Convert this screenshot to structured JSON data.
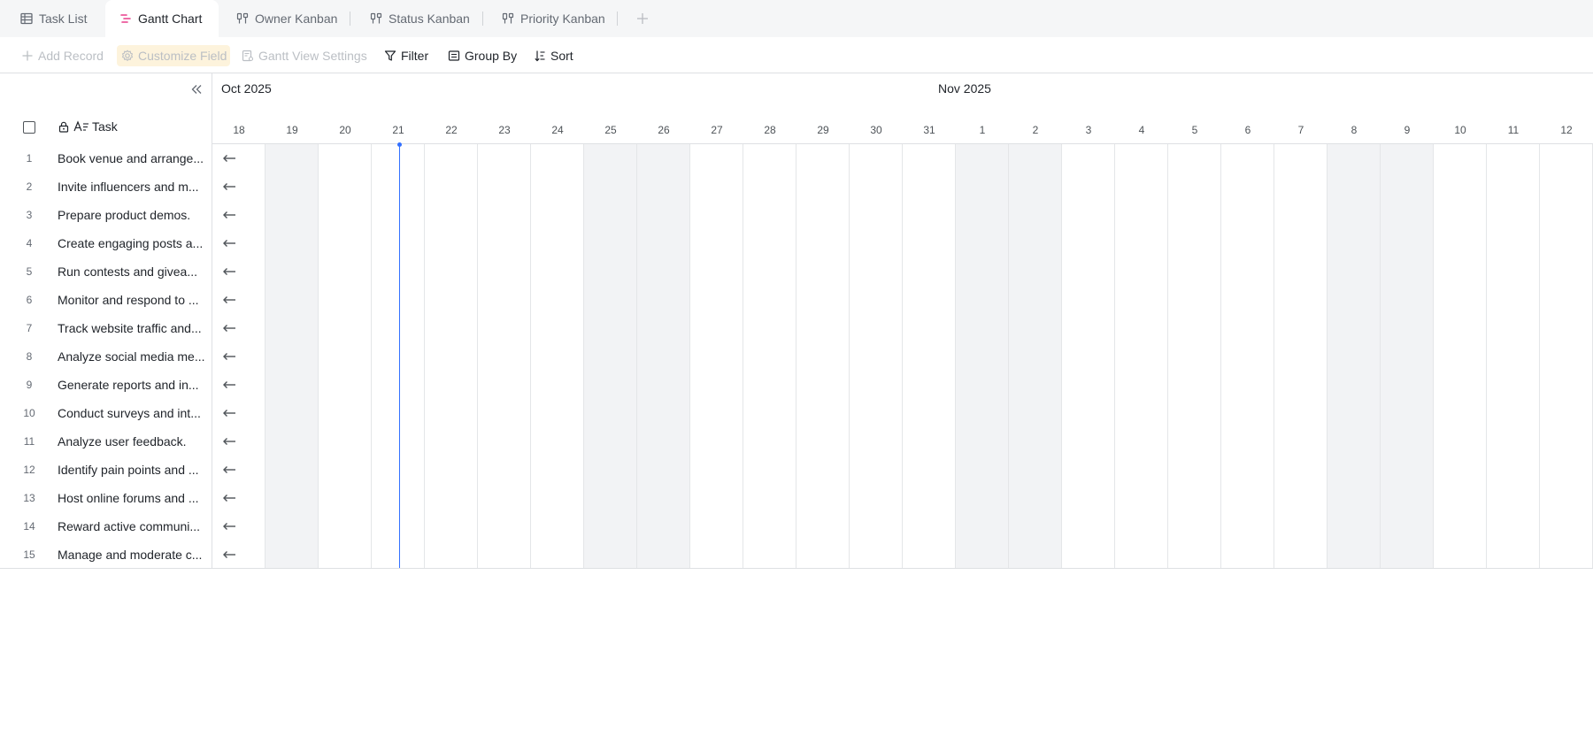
{
  "tabs": [
    {
      "id": "task-list",
      "label": "Task List",
      "icon": "table-icon",
      "active": false
    },
    {
      "id": "gantt-chart",
      "label": "Gantt Chart",
      "icon": "gantt-icon",
      "active": true
    },
    {
      "id": "owner-kanban",
      "label": "Owner Kanban",
      "icon": "kanban-icon",
      "active": false
    },
    {
      "id": "status-kanban",
      "label": "Status Kanban",
      "icon": "kanban-icon",
      "active": false
    },
    {
      "id": "priority-kanban",
      "label": "Priority Kanban",
      "icon": "kanban-icon",
      "active": false
    }
  ],
  "toolbar": {
    "add_record": "Add Record",
    "customize_field": "Customize Field",
    "gantt_view_settings": "Gantt View Settings",
    "filter": "Filter",
    "group_by": "Group By",
    "sort": "Sort"
  },
  "grid": {
    "field_header": "Task",
    "rows": [
      {
        "num": "1",
        "title": "Book venue and arrange..."
      },
      {
        "num": "2",
        "title": "Invite influencers and m..."
      },
      {
        "num": "3",
        "title": "Prepare product demos."
      },
      {
        "num": "4",
        "title": "Create engaging posts a..."
      },
      {
        "num": "5",
        "title": "Run contests and givea..."
      },
      {
        "num": "6",
        "title": "Monitor and respond to ..."
      },
      {
        "num": "7",
        "title": "Track website traffic and..."
      },
      {
        "num": "8",
        "title": "Analyze social media me..."
      },
      {
        "num": "9",
        "title": "Generate reports and in..."
      },
      {
        "num": "10",
        "title": "Conduct surveys and int..."
      },
      {
        "num": "11",
        "title": "Analyze user feedback."
      },
      {
        "num": "12",
        "title": "Identify pain points and ..."
      },
      {
        "num": "13",
        "title": "Host online forums and ..."
      },
      {
        "num": "14",
        "title": "Reward active communi..."
      },
      {
        "num": "15",
        "title": "Manage and moderate c..."
      }
    ]
  },
  "timeline": {
    "months": [
      {
        "label": "Oct 2025",
        "start_index": 0
      },
      {
        "label": "Nov 2025",
        "start_index": 14
      }
    ],
    "days": [
      "18",
      "19",
      "20",
      "21",
      "22",
      "23",
      "24",
      "25",
      "26",
      "27",
      "28",
      "29",
      "30",
      "31",
      "1",
      "2",
      "3",
      "4",
      "5",
      "6",
      "7",
      "8",
      "9",
      "10",
      "11",
      "12"
    ],
    "weekend_indices": [
      1,
      7,
      8,
      14,
      15,
      21,
      22
    ],
    "today_index": 3
  },
  "colors": {
    "accent": "#3370ff",
    "gantt_icon": "#e83e8c",
    "weekend_bg": "#f2f3f5"
  }
}
